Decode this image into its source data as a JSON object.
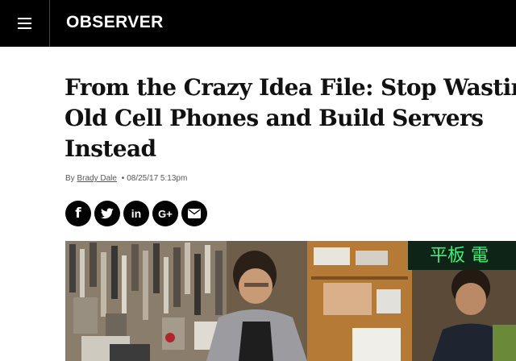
{
  "header": {
    "logo": "OBSERVER",
    "menu_icon": "hamburger-menu-icon"
  },
  "article": {
    "title": "From the Crazy Idea File: Stop Wasting Old Cell Phones and Build Servers Instead",
    "byline_prefix": "By",
    "author": "Brady Dale",
    "separator": "•",
    "date": "08/25/17 5:13pm"
  },
  "share": {
    "facebook": "f",
    "linkedin": "in",
    "google": "G+",
    "twitter_icon": "twitter-icon",
    "email_icon": "email-icon"
  },
  "hero": {
    "sign_text": "平板 電"
  },
  "colors": {
    "topbar": "#000000",
    "sign_green": "#3df07a"
  }
}
